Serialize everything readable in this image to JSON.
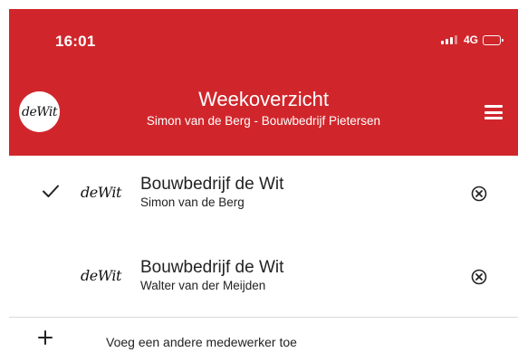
{
  "status_bar": {
    "time": "16:01",
    "network": "4G"
  },
  "app_bar": {
    "logo_text": "deWit",
    "title": "Weekoverzicht",
    "subtitle": "Simon van de Berg - Bouwbedrijf Pietersen"
  },
  "employees": [
    {
      "selected": true,
      "brand_text": "deWit",
      "company": "Bouwbedrijf de Wit",
      "name": "Simon van de Berg"
    },
    {
      "selected": false,
      "brand_text": "deWit",
      "company": "Bouwbedrijf de Wit",
      "name": "Walter van der Meijden"
    }
  ],
  "add_employee": {
    "label": "Voeg een andere medewerker toe"
  },
  "colors": {
    "brand_red": "#d0262b",
    "divider": "#d9d9d9"
  },
  "icons": {
    "check": "check-icon",
    "remove": "remove-circle-icon",
    "add": "plus-icon",
    "menu": "hamburger-menu-icon"
  }
}
